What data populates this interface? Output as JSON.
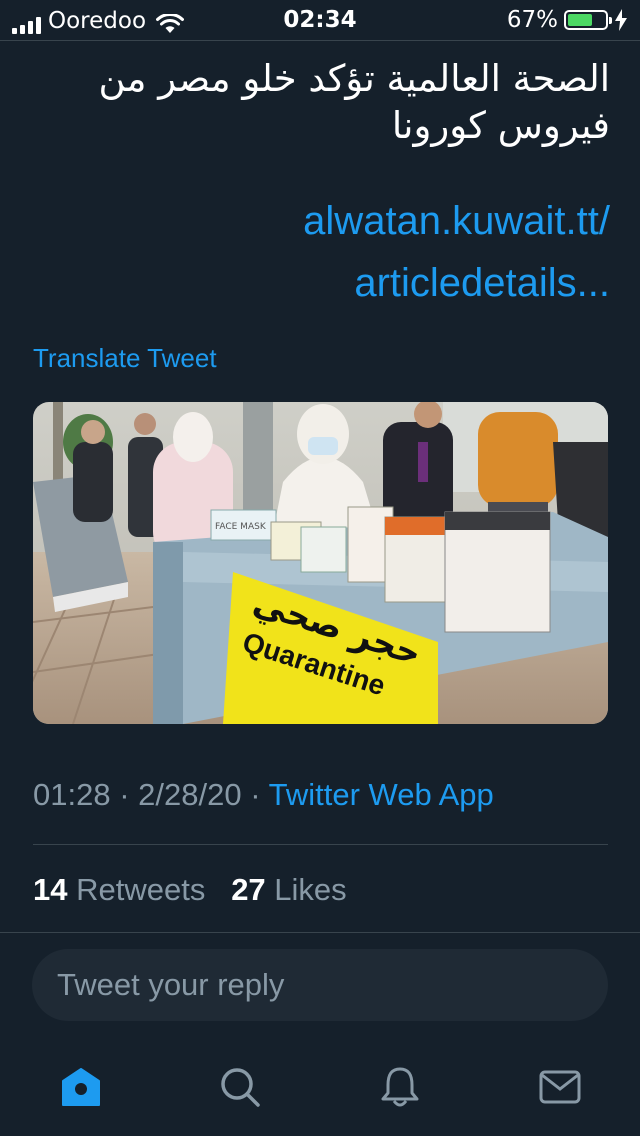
{
  "status_bar": {
    "carrier": "Ooredoo",
    "time": "02:34",
    "battery_percent": "67%",
    "battery_level": 0.67,
    "battery_color": "#4cd964"
  },
  "tweet": {
    "text": "الصحة العالمية تؤكد خلو مصر من فيروس كورونا",
    "link_line1": "alwatan.kuwait.tt/",
    "link_line2": "articledetails...",
    "translate_label": "Translate Tweet",
    "time": "01:28",
    "date": "2/28/20",
    "source": "Twitter Web App",
    "separator": "·",
    "retweets_count": "14",
    "retweets_label": "Retweets",
    "likes_count": "27",
    "likes_label": "Likes",
    "photo": {
      "sign_arabic": "حجر صحي",
      "sign_english": "Quarantine",
      "box_label": "FACE MASK"
    }
  },
  "reply": {
    "placeholder": "Tweet your reply"
  },
  "tabs": [
    {
      "name": "home-icon"
    },
    {
      "name": "search-icon"
    },
    {
      "name": "bell-icon"
    },
    {
      "name": "mail-icon"
    }
  ],
  "colors": {
    "background": "#15202b",
    "accent": "#1d9bf0",
    "muted": "#8899a6",
    "divider": "#38444d"
  }
}
